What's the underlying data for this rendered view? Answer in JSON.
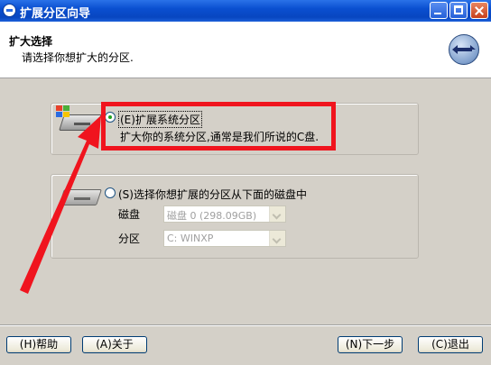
{
  "window": {
    "title": "扩展分区向导",
    "controls": {
      "minimize": "minimize",
      "maximize": "maximize",
      "close": "close"
    }
  },
  "header": {
    "title": "扩大选择",
    "subtitle": "请选择你想扩大的分区.",
    "icon": "resize-arrows-icon"
  },
  "options": [
    {
      "label": "(E)扩展系统分区",
      "description": "扩大你的系统分区,通常是我们所说的C盘.",
      "selected": true
    },
    {
      "label": "(S)选择你想扩展的分区从下面的磁盘中",
      "selected": false
    }
  ],
  "fields": {
    "disk_label": "磁盘",
    "disk_value": "磁盘 0 (298.09GB)",
    "partition_label": "分区",
    "partition_value": "C: WINXP"
  },
  "buttons": {
    "help": "(H)帮助",
    "about": "(A)关于",
    "next": "(N)下一步",
    "quit": "(C)退出"
  },
  "annotation": {
    "highlight_color": "#f0141e"
  }
}
